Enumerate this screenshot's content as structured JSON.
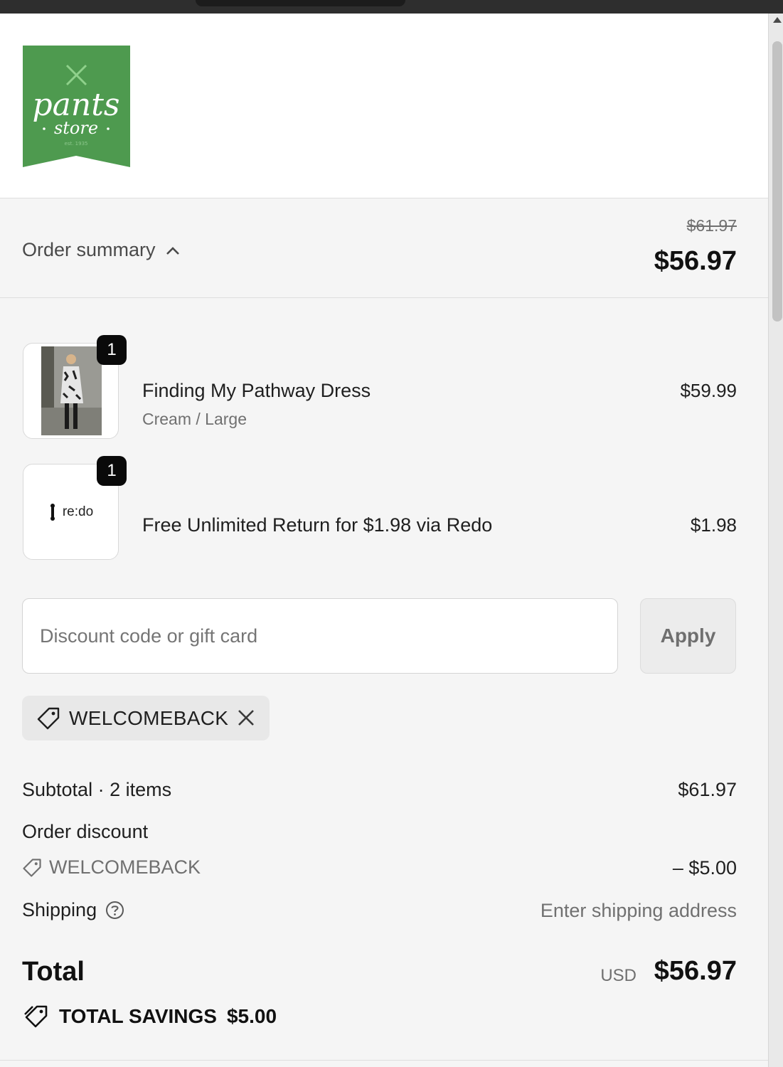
{
  "brand": {
    "logo_text": "pants",
    "logo_subtext": "store",
    "logo_since": "est. 1935",
    "logo_color": "#4e9a4f"
  },
  "summary": {
    "toggle_label": "Order summary",
    "original_total": "$61.97",
    "discounted_total": "$56.97"
  },
  "items": [
    {
      "name": "Finding My Pathway Dress",
      "variant": "Cream / Large",
      "price": "$59.99",
      "quantity": "1"
    },
    {
      "name": "Free Unlimited Return for $1.98 via Redo",
      "price": "$1.98",
      "quantity": "1",
      "thumb_label": "re:do"
    }
  ],
  "discount": {
    "placeholder": "Discount code or gift card",
    "apply_label": "Apply",
    "applied_code": "WELCOMEBACK"
  },
  "totals": {
    "subtotal_label": "Subtotal · 2 items",
    "subtotal_value": "$61.97",
    "order_discount_label": "Order discount",
    "discount_code": "WELCOMEBACK",
    "discount_value": "– $5.00",
    "shipping_label": "Shipping",
    "shipping_value": "Enter shipping address",
    "total_label": "Total",
    "currency": "USD",
    "total_value": "$56.97",
    "savings_label": "TOTAL SAVINGS",
    "savings_value": "$5.00"
  }
}
